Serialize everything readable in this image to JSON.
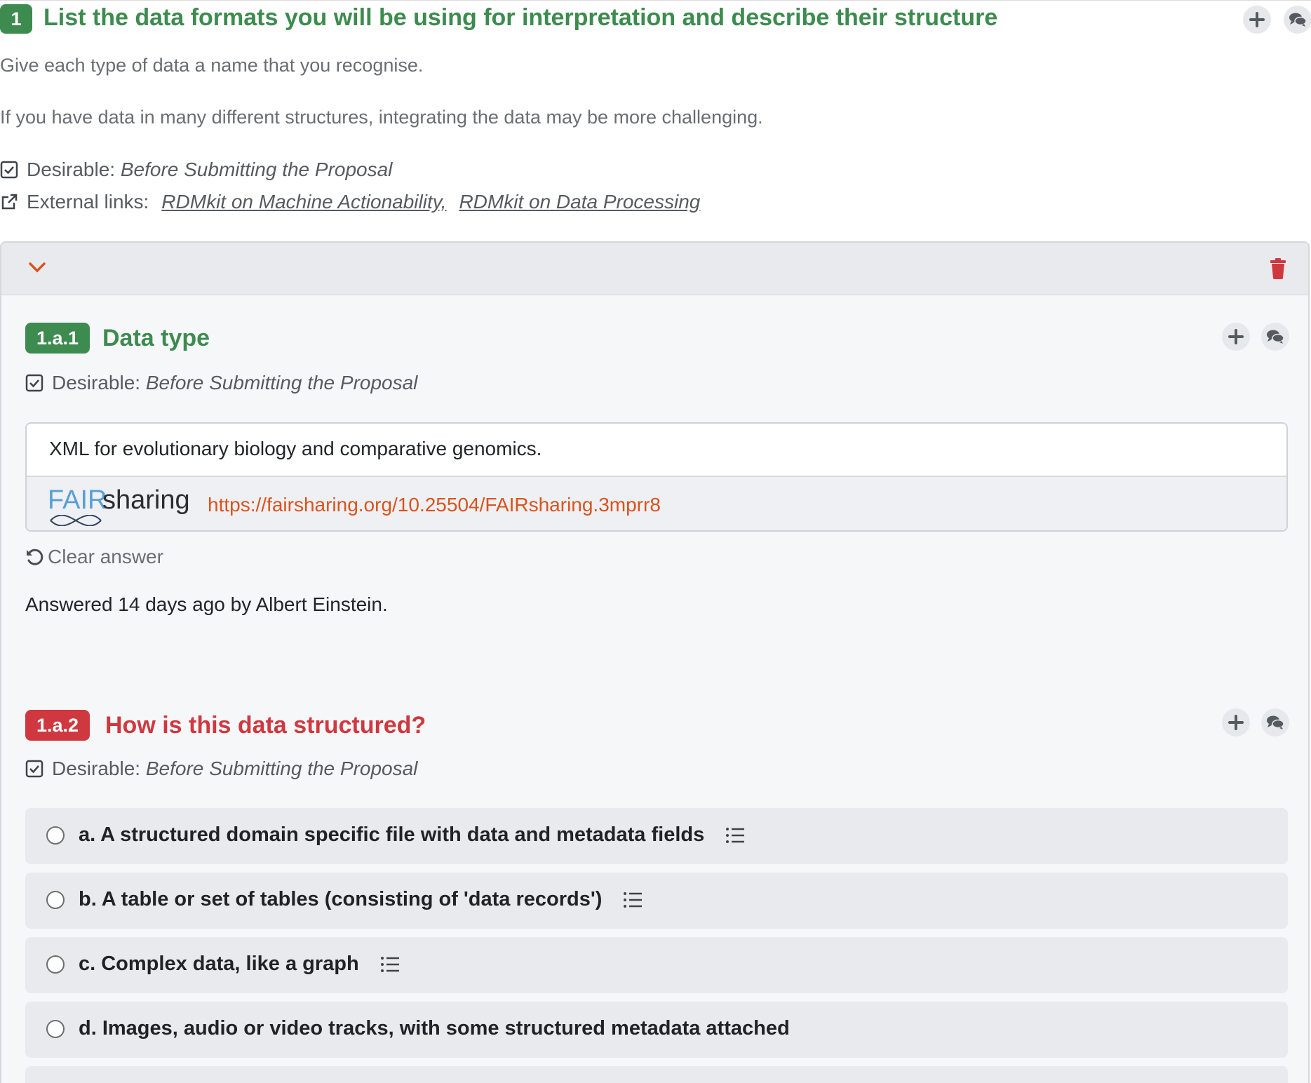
{
  "question": {
    "number": "1",
    "title": "List the data formats you will be using for interpretation and describe their structure",
    "description_1": "Give each type of data a name that you recognise.",
    "description_2": "If you have data in many different structures, integrating the data may be more challenging.",
    "desirable_label": "Desirable:",
    "desirable_value": "Before Submitting the Proposal",
    "external_links_label": "External links:",
    "external_links": [
      "RDMkit on Machine Actionability,",
      "RDMkit on Data Processing"
    ]
  },
  "item": {
    "subquestions": [
      {
        "number": "1.a.1",
        "title": "Data type",
        "desirable_label": "Desirable:",
        "desirable_value": "Before Submitting the Proposal",
        "answer_text": "XML for evolutionary biology and comparative genomics.",
        "logo_text_fair": "FAIR",
        "logo_text_sharing": "sharing",
        "answer_link": "https://fairsharing.org/10.25504/FAIRsharing.3mprr8",
        "clear_answer": "Clear answer",
        "answered_info": "Answered 14 days ago by Albert Einstein."
      },
      {
        "number": "1.a.2",
        "title": "How is this data structured?",
        "desirable_label": "Desirable:",
        "desirable_value": "Before Submitting the Proposal",
        "options": [
          "a. A structured domain specific file with data and metadata fields",
          "b. A table or set of tables (consisting of 'data records')",
          "c. Complex data, like a graph",
          "d. Images, audio or video tracks, with some structured metadata attached"
        ]
      }
    ]
  },
  "colors": {
    "answered_green": "#3d8b4f",
    "unanswered_red": "#d0383f",
    "link_orange": "#d9541e",
    "delete_red": "#d0383f"
  },
  "icons": [
    "plus-icon",
    "comments-icon",
    "check-square-icon",
    "external-link-icon",
    "chevron-down-icon",
    "trash-icon",
    "undo-icon",
    "list-icon"
  ]
}
